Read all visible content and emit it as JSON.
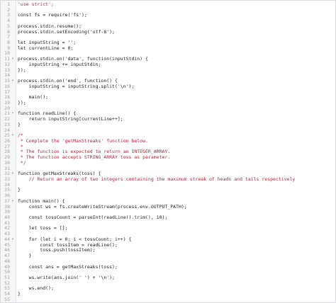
{
  "editor": {
    "lines": [
      {
        "n": "1",
        "fold": "",
        "code": "'use strict';",
        "cls": "str"
      },
      {
        "n": "2",
        "fold": "",
        "code": "",
        "cls": ""
      },
      {
        "n": "3",
        "fold": "",
        "code": "const fs = require('fs');",
        "cls": ""
      },
      {
        "n": "4",
        "fold": "",
        "code": "",
        "cls": ""
      },
      {
        "n": "5",
        "fold": "",
        "code": "process.stdin.resume();",
        "cls": ""
      },
      {
        "n": "6",
        "fold": "",
        "code": "process.stdin.setEncoding('utf-8');",
        "cls": ""
      },
      {
        "n": "7",
        "fold": "",
        "code": "",
        "cls": ""
      },
      {
        "n": "8",
        "fold": "",
        "code": "let inputString = '';",
        "cls": ""
      },
      {
        "n": "9",
        "fold": "",
        "code": "let currentLine = 0;",
        "cls": ""
      },
      {
        "n": "10",
        "fold": "",
        "code": "",
        "cls": ""
      },
      {
        "n": "11",
        "fold": "▾",
        "code": "process.stdin.on('data', function(inputStdin) {",
        "cls": ""
      },
      {
        "n": "12",
        "fold": "",
        "code": "    inputString += inputStdin;",
        "cls": ""
      },
      {
        "n": "13",
        "fold": "",
        "code": "});",
        "cls": ""
      },
      {
        "n": "14",
        "fold": "",
        "code": "",
        "cls": ""
      },
      {
        "n": "15",
        "fold": "▾",
        "code": "process.stdin.on('end', function() {",
        "cls": ""
      },
      {
        "n": "16",
        "fold": "",
        "code": "    inputString = inputString.split('\\n');",
        "cls": ""
      },
      {
        "n": "17",
        "fold": "",
        "code": "",
        "cls": ""
      },
      {
        "n": "18",
        "fold": "",
        "code": "    main();",
        "cls": ""
      },
      {
        "n": "19",
        "fold": "",
        "code": "});",
        "cls": ""
      },
      {
        "n": "20",
        "fold": "",
        "code": "",
        "cls": ""
      },
      {
        "n": "21",
        "fold": "▾",
        "code": "function readLine() {",
        "cls": ""
      },
      {
        "n": "22",
        "fold": "",
        "code": "    return inputString[currentLine++];",
        "cls": ""
      },
      {
        "n": "23",
        "fold": "",
        "code": "}",
        "cls": ""
      },
      {
        "n": "24",
        "fold": "",
        "code": "",
        "cls": ""
      },
      {
        "n": "25",
        "fold": "▾",
        "code": "/*",
        "cls": "com"
      },
      {
        "n": "26",
        "fold": "",
        "code": " * Complete the 'getMaxStreaks' function below.",
        "cls": "com"
      },
      {
        "n": "27",
        "fold": "",
        "code": " *",
        "cls": "com"
      },
      {
        "n": "28",
        "fold": "",
        "code": " * The function is expected to return an INTEGER_ARRAY.",
        "cls": "com"
      },
      {
        "n": "29",
        "fold": "",
        "code": " * The function accepts STRING_ARRAY toss as parameter.",
        "cls": "com"
      },
      {
        "n": "30",
        "fold": "",
        "code": " */",
        "cls": "com"
      },
      {
        "n": "31",
        "fold": "",
        "code": "",
        "cls": ""
      },
      {
        "n": "32",
        "fold": "▾",
        "code": "function getMaxStreaks(toss) {",
        "cls": ""
      },
      {
        "n": "33",
        "fold": "",
        "code": "    // Return an array of two integers containing the maximum streak of heads and tails respectively",
        "cls": "com"
      },
      {
        "n": "34",
        "fold": "",
        "code": "",
        "cls": ""
      },
      {
        "n": "35",
        "fold": "",
        "code": "}",
        "cls": ""
      },
      {
        "n": "36",
        "fold": "",
        "code": "",
        "cls": ""
      },
      {
        "n": "37",
        "fold": "▾",
        "code": "function main() {",
        "cls": ""
      },
      {
        "n": "38",
        "fold": "",
        "code": "    const ws = fs.createWriteStream(process.env.OUTPUT_PATH);",
        "cls": ""
      },
      {
        "n": "39",
        "fold": "",
        "code": "",
        "cls": ""
      },
      {
        "n": "40",
        "fold": "",
        "code": "    const tossCount = parseInt(readLine().trim(), 10);",
        "cls": ""
      },
      {
        "n": "41",
        "fold": "",
        "code": "",
        "cls": ""
      },
      {
        "n": "42",
        "fold": "",
        "code": "    let toss = [];",
        "cls": ""
      },
      {
        "n": "43",
        "fold": "",
        "code": "",
        "cls": ""
      },
      {
        "n": "44",
        "fold": "▾",
        "code": "    for (let i = 0; i < tossCount; i++) {",
        "cls": ""
      },
      {
        "n": "45",
        "fold": "",
        "code": "        const tossItem = readLine();",
        "cls": ""
      },
      {
        "n": "46",
        "fold": "",
        "code": "        toss.push(tossItem);",
        "cls": ""
      },
      {
        "n": "47",
        "fold": "",
        "code": "    }",
        "cls": ""
      },
      {
        "n": "48",
        "fold": "",
        "code": "",
        "cls": ""
      },
      {
        "n": "49",
        "fold": "",
        "code": "    const ans = getMaxStreaks(toss);",
        "cls": ""
      },
      {
        "n": "50",
        "fold": "",
        "code": "",
        "cls": ""
      },
      {
        "n": "51",
        "fold": "",
        "code": "    ws.write(ans.join(' ') + '\\n');",
        "cls": ""
      },
      {
        "n": "52",
        "fold": "",
        "code": "",
        "cls": ""
      },
      {
        "n": "53",
        "fold": "",
        "code": "    ws.end();",
        "cls": ""
      },
      {
        "n": "54",
        "fold": "",
        "code": "}",
        "cls": ""
      },
      {
        "n": "55",
        "fold": "",
        "code": "",
        "cls": ""
      }
    ],
    "colors": {
      "keyword": "#1c5fb0",
      "string": "#b3203a",
      "comment": "#b3203a",
      "number": "#2a7a2a",
      "gutter_bg": "#f5f6f7",
      "line_number": "#9aa0a6"
    }
  }
}
